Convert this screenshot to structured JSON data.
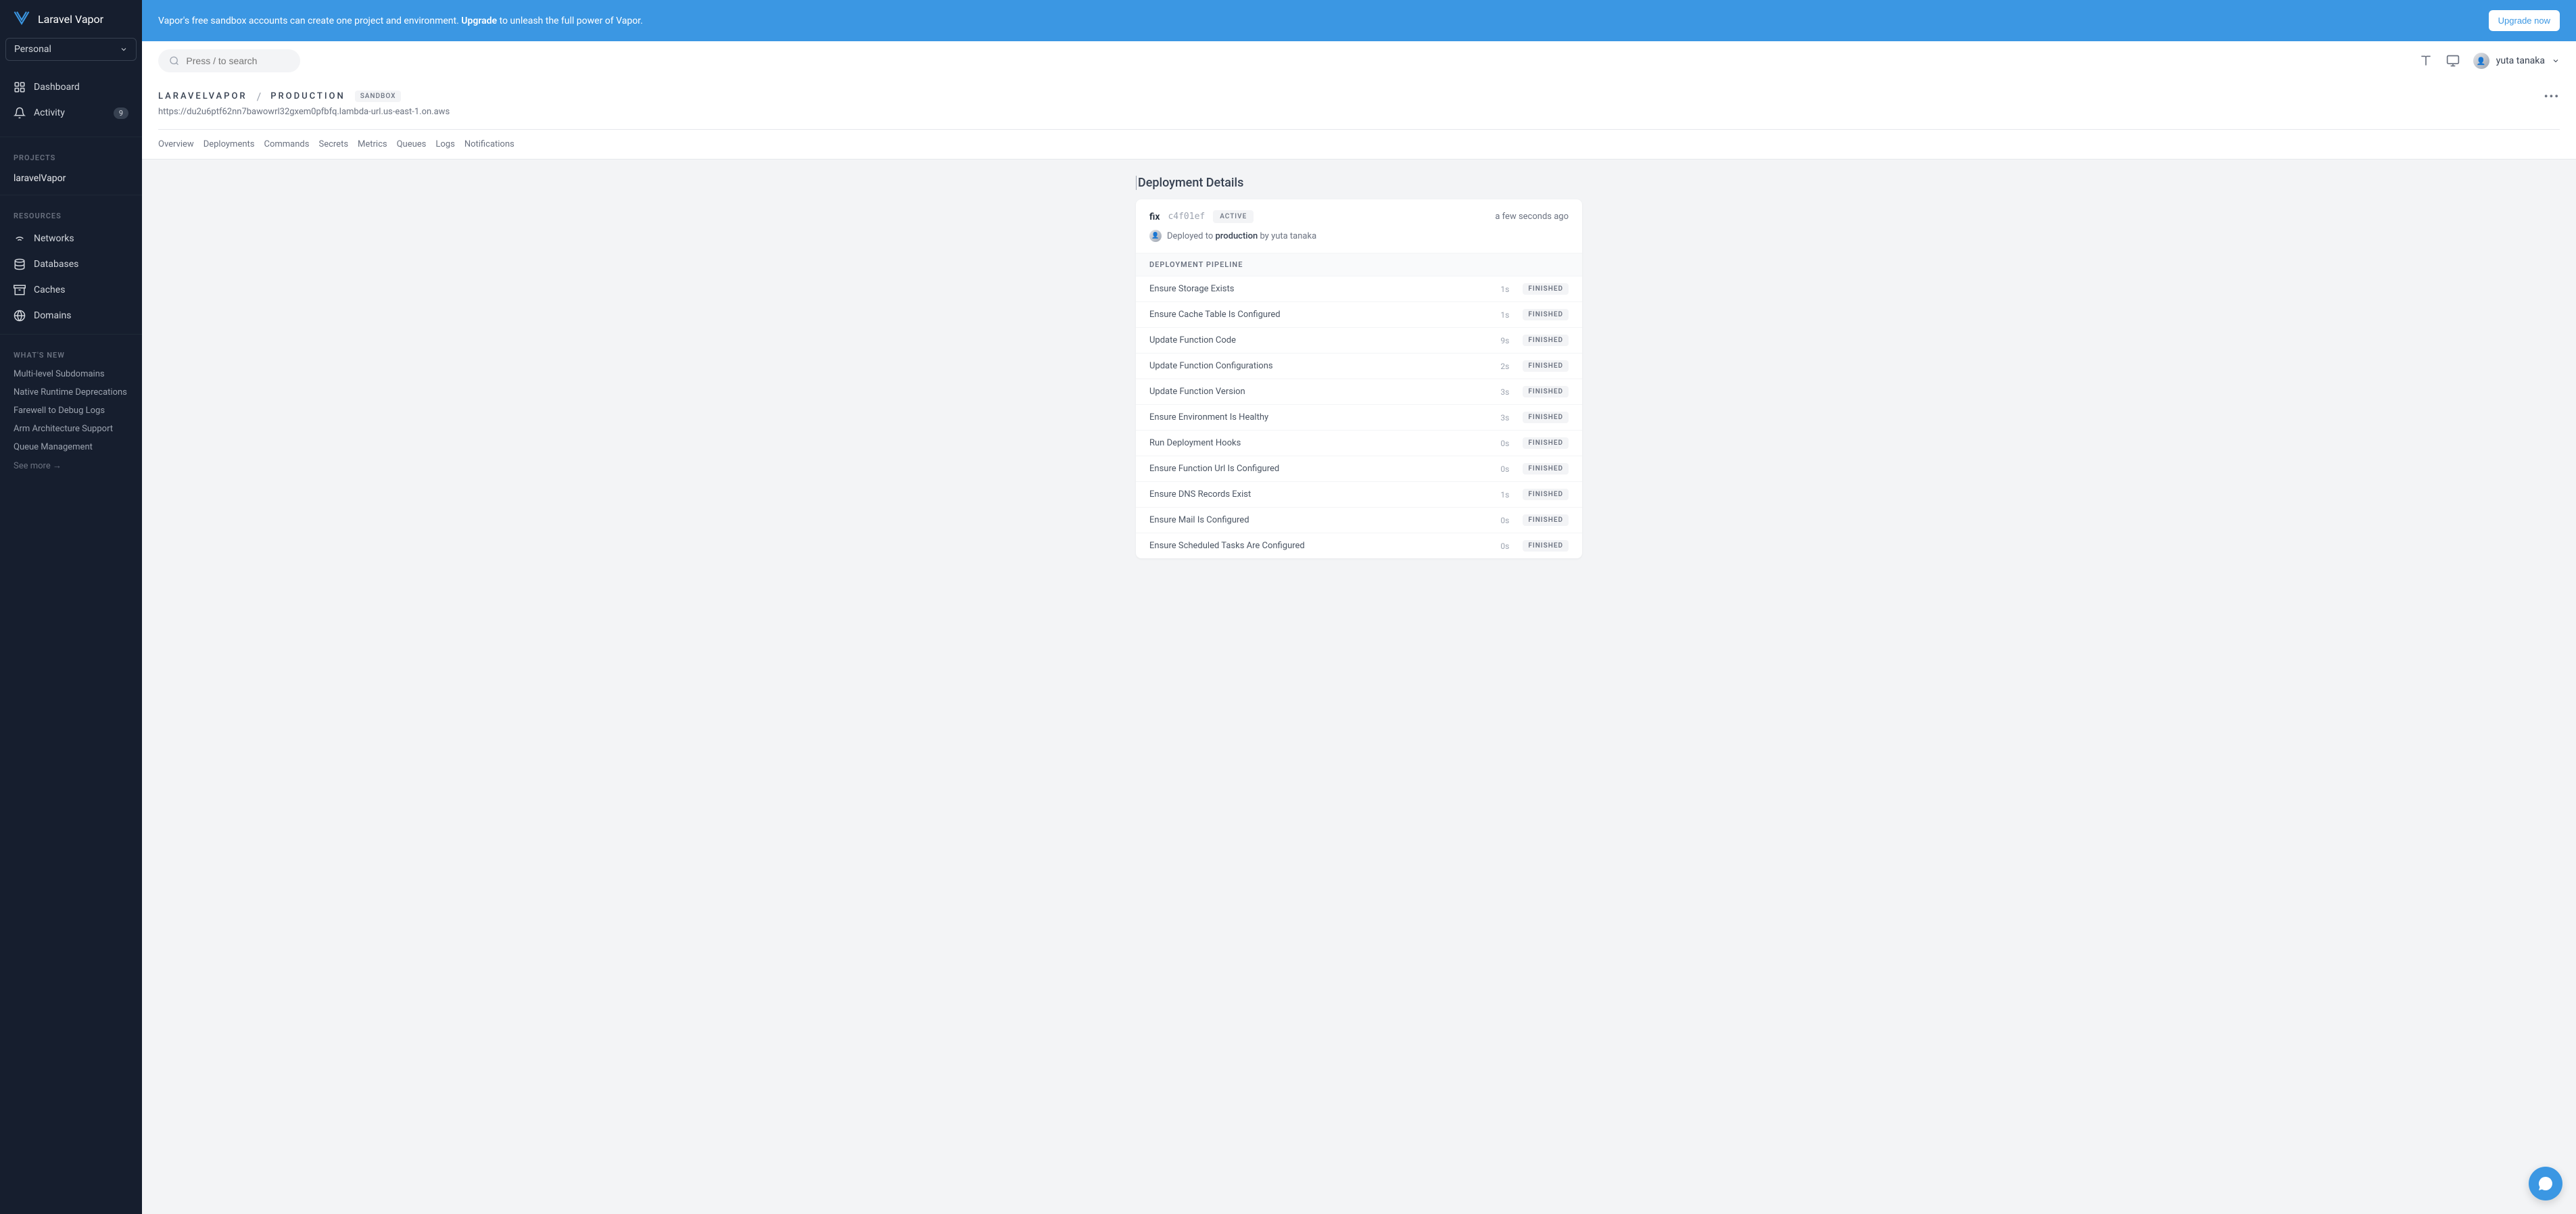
{
  "brand": "Laravel Vapor",
  "team": "Personal",
  "nav": {
    "dashboard": "Dashboard",
    "activity": "Activity",
    "activity_badge": "9"
  },
  "sections": {
    "projects": "PROJECTS",
    "resources": "RESOURCES",
    "whatsnew": "WHAT'S NEW"
  },
  "projects": [
    "laravelVapor"
  ],
  "resources": {
    "networks": "Networks",
    "databases": "Databases",
    "caches": "Caches",
    "domains": "Domains"
  },
  "news": [
    "Multi-level Subdomains",
    "Native Runtime Deprecations",
    "Farewell to Debug Logs",
    "Arm Architecture Support",
    "Queue Management"
  ],
  "see_more": "See more →",
  "banner": {
    "text_a": "Vapor's free sandbox accounts can create one project and environment. ",
    "text_b": "Upgrade",
    "text_c": " to unleash the full power of Vapor.",
    "button": "Upgrade now"
  },
  "search_placeholder": "Press / to search",
  "user_name": "yuta tanaka",
  "breadcrumb": {
    "project": "LARAVELVAPOR",
    "env": "PRODUCTION",
    "badge": "SANDBOX"
  },
  "url": "https://du2u6ptf62nn7bawowrl32gxem0pfbfq.lambda-url.us-east-1.on.aws",
  "tabs": [
    "Overview",
    "Deployments",
    "Commands",
    "Secrets",
    "Metrics",
    "Queues",
    "Logs",
    "Notifications"
  ],
  "details_title": "Deployment Details",
  "deployment": {
    "message": "fix",
    "hash": "c4f01ef",
    "status": "ACTIVE",
    "time": "a few seconds ago",
    "deployed_to_prefix": "Deployed to ",
    "deployed_to_env": "production",
    "deployed_by_prefix": " by ",
    "deployed_by": "yuta tanaka"
  },
  "pipeline_label": "DEPLOYMENT PIPELINE",
  "steps": [
    {
      "name": "Ensure Storage Exists",
      "time": "1s",
      "status": "FINISHED"
    },
    {
      "name": "Ensure Cache Table Is Configured",
      "time": "1s",
      "status": "FINISHED"
    },
    {
      "name": "Update Function Code",
      "time": "9s",
      "status": "FINISHED"
    },
    {
      "name": "Update Function Configurations",
      "time": "2s",
      "status": "FINISHED"
    },
    {
      "name": "Update Function Version",
      "time": "3s",
      "status": "FINISHED"
    },
    {
      "name": "Ensure Environment Is Healthy",
      "time": "3s",
      "status": "FINISHED"
    },
    {
      "name": "Run Deployment Hooks",
      "time": "0s",
      "status": "FINISHED"
    },
    {
      "name": "Ensure Function Url Is Configured",
      "time": "0s",
      "status": "FINISHED"
    },
    {
      "name": "Ensure DNS Records Exist",
      "time": "1s",
      "status": "FINISHED"
    },
    {
      "name": "Ensure Mail Is Configured",
      "time": "0s",
      "status": "FINISHED"
    },
    {
      "name": "Ensure Scheduled Tasks Are Configured",
      "time": "0s",
      "status": "FINISHED"
    }
  ]
}
